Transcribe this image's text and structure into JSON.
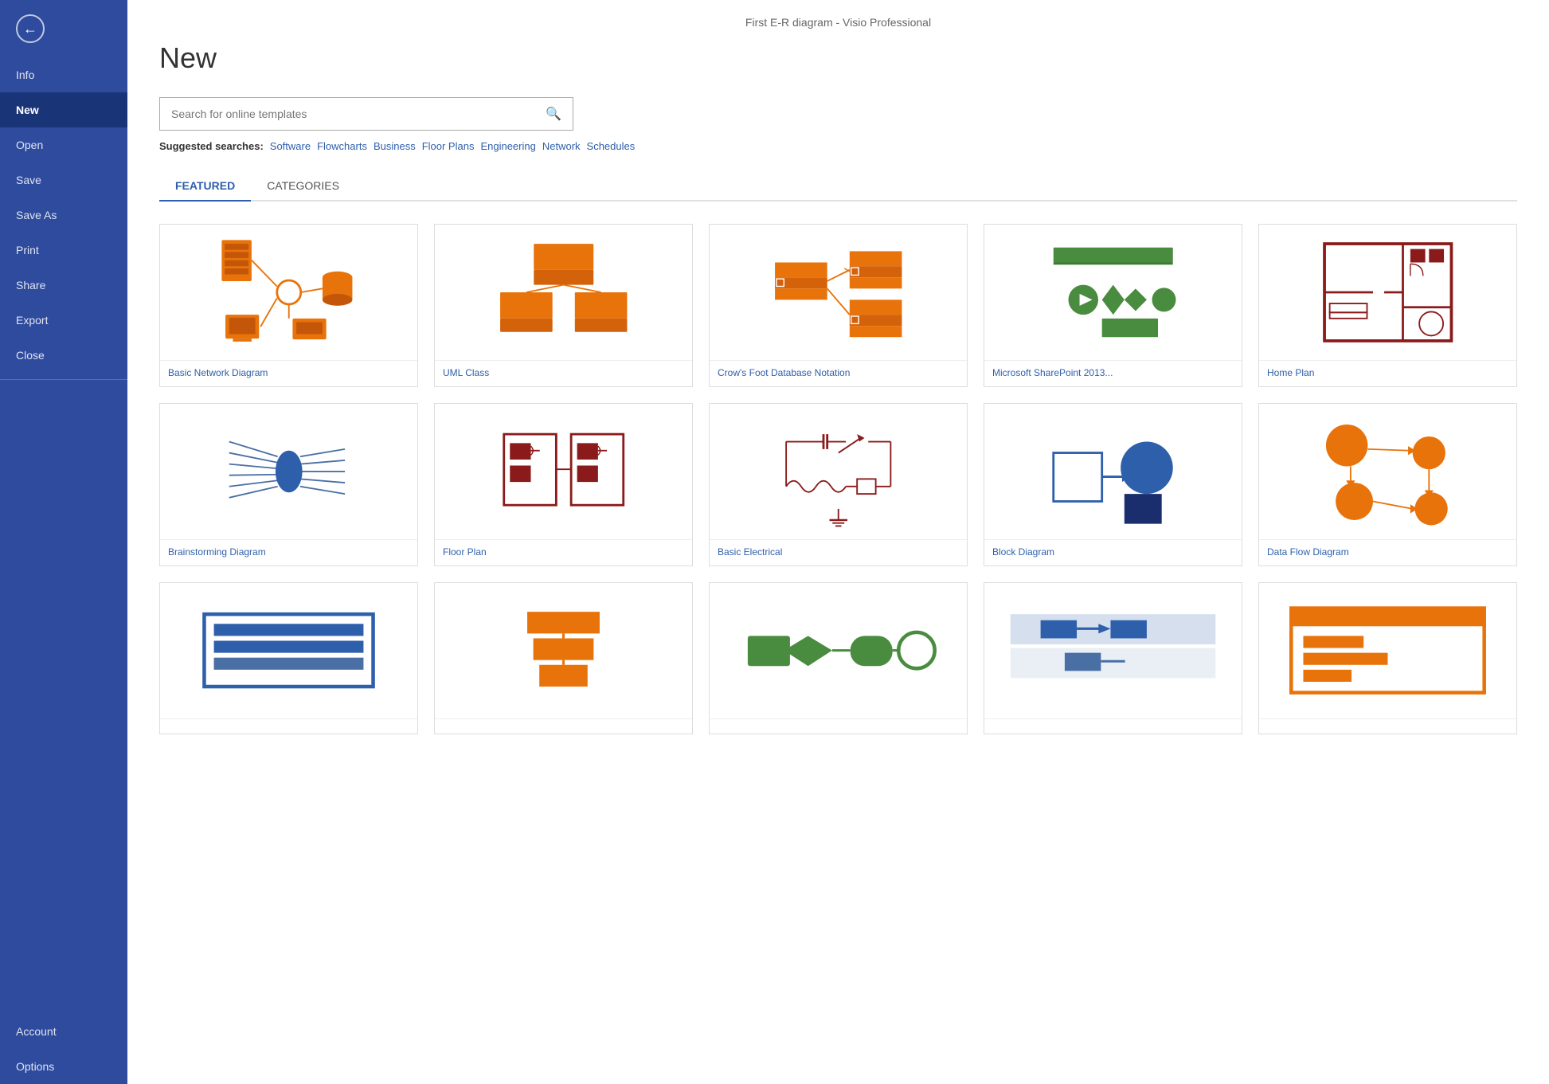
{
  "window_title": "First E-R diagram - Visio Professional",
  "sidebar": {
    "back_label": "←",
    "items": [
      {
        "id": "info",
        "label": "Info",
        "active": false
      },
      {
        "id": "new",
        "label": "New",
        "active": true
      },
      {
        "id": "open",
        "label": "Open",
        "active": false
      },
      {
        "id": "save",
        "label": "Save",
        "active": false
      },
      {
        "id": "save-as",
        "label": "Save As",
        "active": false
      },
      {
        "id": "print",
        "label": "Print",
        "active": false
      },
      {
        "id": "share",
        "label": "Share",
        "active": false
      },
      {
        "id": "export",
        "label": "Export",
        "active": false
      },
      {
        "id": "close",
        "label": "Close",
        "active": false
      }
    ],
    "bottom_items": [
      {
        "id": "account",
        "label": "Account"
      },
      {
        "id": "options",
        "label": "Options"
      }
    ]
  },
  "main": {
    "page_title": "New",
    "search_placeholder": "Search for online templates",
    "search_icon": "🔍",
    "suggested_label": "Suggested searches:",
    "suggested_links": [
      "Software",
      "Flowcharts",
      "Business",
      "Floor Plans",
      "Engineering",
      "Network",
      "Schedules"
    ],
    "tabs": [
      {
        "id": "featured",
        "label": "FEATURED",
        "active": true
      },
      {
        "id": "categories",
        "label": "CATEGORIES",
        "active": false
      }
    ],
    "templates_row1": [
      {
        "id": "basic-network",
        "name": "Basic Network Diagram"
      },
      {
        "id": "uml-class",
        "name": "UML Class"
      },
      {
        "id": "crows-foot",
        "name": "Crow's Foot Database Notation"
      },
      {
        "id": "sharepoint",
        "name": "Microsoft SharePoint 2013..."
      },
      {
        "id": "home-plan",
        "name": "Home Plan"
      }
    ],
    "templates_row2": [
      {
        "id": "brainstorming",
        "name": "Brainstorming Diagram"
      },
      {
        "id": "floor-plan",
        "name": "Floor Plan"
      },
      {
        "id": "basic-electrical",
        "name": "Basic Electrical"
      },
      {
        "id": "block-diagram",
        "name": "Block Diagram"
      },
      {
        "id": "data-flow",
        "name": "Data Flow Diagram"
      }
    ],
    "templates_row3": [
      {
        "id": "rack",
        "name": ""
      },
      {
        "id": "sdl",
        "name": ""
      },
      {
        "id": "flowchart",
        "name": ""
      },
      {
        "id": "cross-functional",
        "name": ""
      },
      {
        "id": "more",
        "name": ""
      }
    ]
  },
  "colors": {
    "accent": "#2E5FAB",
    "sidebar_bg": "#2E4B9E",
    "orange": "#E8730A",
    "dark_red": "#8B1A1A",
    "green": "#4A8C3F",
    "blue": "#2E5FAB"
  }
}
